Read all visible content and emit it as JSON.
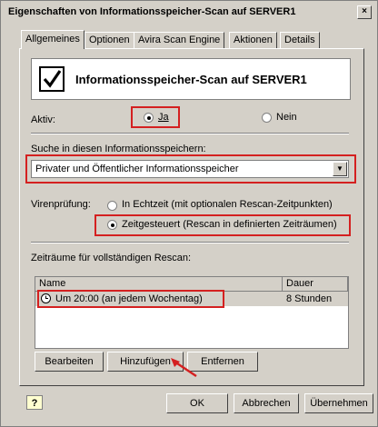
{
  "window": {
    "title": "Eigenschaften von Informationsspeicher-Scan auf SERVER1",
    "close_glyph": "×"
  },
  "tabs": [
    {
      "label": "Allgemeines",
      "active": true
    },
    {
      "label": "Optionen",
      "active": false
    },
    {
      "label": "Avira Scan Engine",
      "active": false
    },
    {
      "label": "Aktionen",
      "active": false
    },
    {
      "label": "Details",
      "active": false
    }
  ],
  "header": {
    "title": "Informationsspeicher-Scan auf SERVER1",
    "icon": "check-icon"
  },
  "aktiv": {
    "label": "Aktiv:",
    "yes_label": "Ja",
    "no_label": "Nein",
    "selected": "Ja"
  },
  "suche": {
    "label": "Suche in diesen Informationsspeichern:",
    "selected_value": "Privater und Öffentlicher Informationsspeicher"
  },
  "virenpruefung": {
    "label": "Virenprüfung:",
    "option_realtime": "In Echtzeit (mit optionalen Rescan-Zeitpunkten)",
    "option_scheduled": "Zeitgesteuert (Rescan in definierten Zeiträumen)",
    "selected": "Zeitgesteuert"
  },
  "zeitraeume": {
    "label": "Zeiträume für vollständigen Rescan:",
    "columns": [
      "Name",
      "Dauer"
    ],
    "rows": [
      {
        "name": "Um 20:00 (an jedem Wochentag)",
        "dauer": "8 Stunden"
      }
    ]
  },
  "list_buttons": {
    "edit": "Bearbeiten",
    "add": "Hinzufügen",
    "remove": "Entfernen"
  },
  "footer": {
    "ok": "OK",
    "cancel": "Abbrechen",
    "apply": "Übernehmen",
    "help_icon": "help-icon"
  },
  "colors": {
    "highlight_red": "#d42020",
    "face": "#d4d0c8"
  }
}
